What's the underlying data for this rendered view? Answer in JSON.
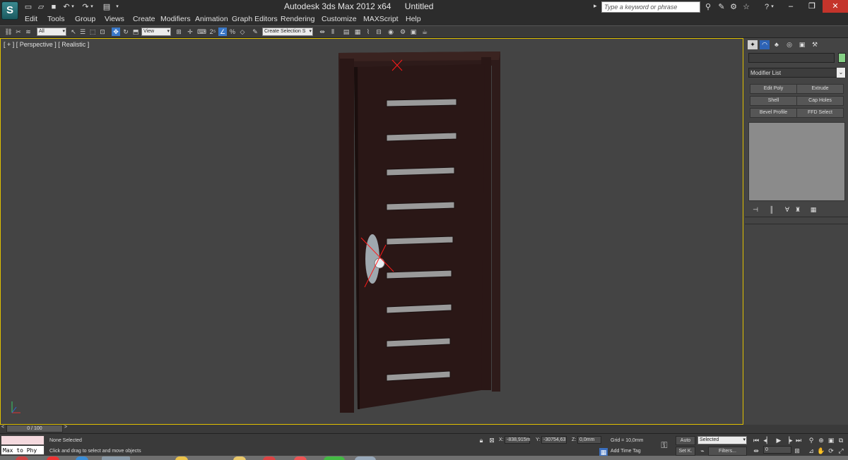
{
  "app": {
    "logo_letter": "S",
    "title": "Autodesk 3ds Max  2012 x64",
    "document": "Untitled",
    "search_placeholder": "Type a keyword or phrase"
  },
  "menu": [
    "Edit",
    "Tools",
    "Group",
    "Views",
    "Create",
    "Modifiers",
    "Animation",
    "Graph Editors",
    "Rendering",
    "Customize",
    "MAXScript",
    "Help"
  ],
  "toolbar": {
    "selection_filter": "All",
    "reference_coord": "View",
    "named_selection": "Create Selection S"
  },
  "viewport": {
    "label": "[ + ] [ Perspective ] [ Realistic ]",
    "door_color": "#2a1716",
    "frame_color": "#2e1b1a",
    "slot_color": "#9a9a9a"
  },
  "command_panel": {
    "modifier_list": "Modifier List",
    "buttons": [
      "Edit Poly",
      "Extrude",
      "Shell",
      "Cap Holes",
      "Bevel Profile",
      "FFD Select"
    ],
    "object_color": "#86d186"
  },
  "timeline": {
    "frame": "0 / 100"
  },
  "status": {
    "maxscript_input": "Max to Phy",
    "selection": "None Selected",
    "prompt": "Click and drag to select and move objects",
    "x_label": "X:",
    "x_value": "-838,915m",
    "y_label": "Y:",
    "y_value": "-30754,63",
    "z_label": "Z:",
    "z_value": "0,0mm",
    "grid": "Grid = 10,0mm",
    "add_time_tag": "Add Time Tag",
    "auto_key": "Auto",
    "set_key": "Set K.",
    "key_mode": "Selected",
    "filters": "Filters...",
    "current_frame": "0"
  }
}
